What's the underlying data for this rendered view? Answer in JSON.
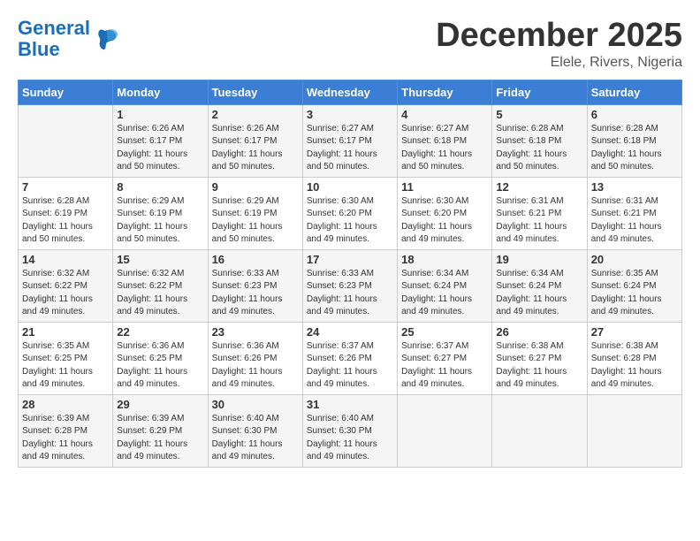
{
  "header": {
    "logo_line1": "General",
    "logo_line2": "Blue",
    "month_title": "December 2025",
    "location": "Elele, Rivers, Nigeria"
  },
  "days_of_week": [
    "Sunday",
    "Monday",
    "Tuesday",
    "Wednesday",
    "Thursday",
    "Friday",
    "Saturday"
  ],
  "weeks": [
    [
      {
        "day": "",
        "info": ""
      },
      {
        "day": "1",
        "info": "Sunrise: 6:26 AM\nSunset: 6:17 PM\nDaylight: 11 hours\nand 50 minutes."
      },
      {
        "day": "2",
        "info": "Sunrise: 6:26 AM\nSunset: 6:17 PM\nDaylight: 11 hours\nand 50 minutes."
      },
      {
        "day": "3",
        "info": "Sunrise: 6:27 AM\nSunset: 6:17 PM\nDaylight: 11 hours\nand 50 minutes."
      },
      {
        "day": "4",
        "info": "Sunrise: 6:27 AM\nSunset: 6:18 PM\nDaylight: 11 hours\nand 50 minutes."
      },
      {
        "day": "5",
        "info": "Sunrise: 6:28 AM\nSunset: 6:18 PM\nDaylight: 11 hours\nand 50 minutes."
      },
      {
        "day": "6",
        "info": "Sunrise: 6:28 AM\nSunset: 6:18 PM\nDaylight: 11 hours\nand 50 minutes."
      }
    ],
    [
      {
        "day": "7",
        "info": "Sunrise: 6:28 AM\nSunset: 6:19 PM\nDaylight: 11 hours\nand 50 minutes."
      },
      {
        "day": "8",
        "info": "Sunrise: 6:29 AM\nSunset: 6:19 PM\nDaylight: 11 hours\nand 50 minutes."
      },
      {
        "day": "9",
        "info": "Sunrise: 6:29 AM\nSunset: 6:19 PM\nDaylight: 11 hours\nand 50 minutes."
      },
      {
        "day": "10",
        "info": "Sunrise: 6:30 AM\nSunset: 6:20 PM\nDaylight: 11 hours\nand 49 minutes."
      },
      {
        "day": "11",
        "info": "Sunrise: 6:30 AM\nSunset: 6:20 PM\nDaylight: 11 hours\nand 49 minutes."
      },
      {
        "day": "12",
        "info": "Sunrise: 6:31 AM\nSunset: 6:21 PM\nDaylight: 11 hours\nand 49 minutes."
      },
      {
        "day": "13",
        "info": "Sunrise: 6:31 AM\nSunset: 6:21 PM\nDaylight: 11 hours\nand 49 minutes."
      }
    ],
    [
      {
        "day": "14",
        "info": "Sunrise: 6:32 AM\nSunset: 6:22 PM\nDaylight: 11 hours\nand 49 minutes."
      },
      {
        "day": "15",
        "info": "Sunrise: 6:32 AM\nSunset: 6:22 PM\nDaylight: 11 hours\nand 49 minutes."
      },
      {
        "day": "16",
        "info": "Sunrise: 6:33 AM\nSunset: 6:23 PM\nDaylight: 11 hours\nand 49 minutes."
      },
      {
        "day": "17",
        "info": "Sunrise: 6:33 AM\nSunset: 6:23 PM\nDaylight: 11 hours\nand 49 minutes."
      },
      {
        "day": "18",
        "info": "Sunrise: 6:34 AM\nSunset: 6:24 PM\nDaylight: 11 hours\nand 49 minutes."
      },
      {
        "day": "19",
        "info": "Sunrise: 6:34 AM\nSunset: 6:24 PM\nDaylight: 11 hours\nand 49 minutes."
      },
      {
        "day": "20",
        "info": "Sunrise: 6:35 AM\nSunset: 6:24 PM\nDaylight: 11 hours\nand 49 minutes."
      }
    ],
    [
      {
        "day": "21",
        "info": "Sunrise: 6:35 AM\nSunset: 6:25 PM\nDaylight: 11 hours\nand 49 minutes."
      },
      {
        "day": "22",
        "info": "Sunrise: 6:36 AM\nSunset: 6:25 PM\nDaylight: 11 hours\nand 49 minutes."
      },
      {
        "day": "23",
        "info": "Sunrise: 6:36 AM\nSunset: 6:26 PM\nDaylight: 11 hours\nand 49 minutes."
      },
      {
        "day": "24",
        "info": "Sunrise: 6:37 AM\nSunset: 6:26 PM\nDaylight: 11 hours\nand 49 minutes."
      },
      {
        "day": "25",
        "info": "Sunrise: 6:37 AM\nSunset: 6:27 PM\nDaylight: 11 hours\nand 49 minutes."
      },
      {
        "day": "26",
        "info": "Sunrise: 6:38 AM\nSunset: 6:27 PM\nDaylight: 11 hours\nand 49 minutes."
      },
      {
        "day": "27",
        "info": "Sunrise: 6:38 AM\nSunset: 6:28 PM\nDaylight: 11 hours\nand 49 minutes."
      }
    ],
    [
      {
        "day": "28",
        "info": "Sunrise: 6:39 AM\nSunset: 6:28 PM\nDaylight: 11 hours\nand 49 minutes."
      },
      {
        "day": "29",
        "info": "Sunrise: 6:39 AM\nSunset: 6:29 PM\nDaylight: 11 hours\nand 49 minutes."
      },
      {
        "day": "30",
        "info": "Sunrise: 6:40 AM\nSunset: 6:30 PM\nDaylight: 11 hours\nand 49 minutes."
      },
      {
        "day": "31",
        "info": "Sunrise: 6:40 AM\nSunset: 6:30 PM\nDaylight: 11 hours\nand 49 minutes."
      },
      {
        "day": "",
        "info": ""
      },
      {
        "day": "",
        "info": ""
      },
      {
        "day": "",
        "info": ""
      }
    ]
  ]
}
